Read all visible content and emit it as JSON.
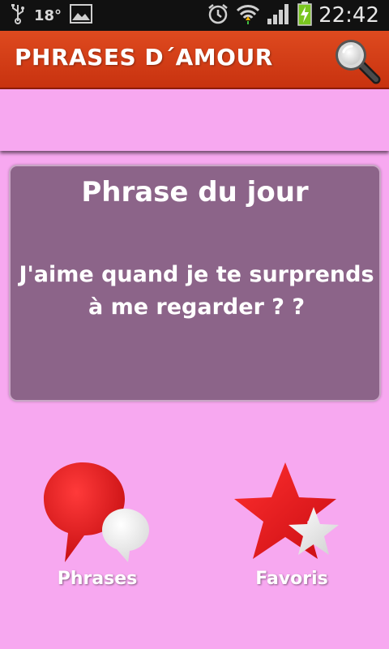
{
  "status_bar": {
    "temperature": "18°",
    "time": "22:42",
    "icons": [
      "usb-icon",
      "picture-icon",
      "alarm-icon",
      "wifi-icon",
      "signal-icon",
      "battery-charging-icon"
    ]
  },
  "action_bar": {
    "title": "PHRASES D´AMOUR",
    "search_icon": "search-icon"
  },
  "card": {
    "title": "Phrase du jour",
    "phrase": "J'aime quand je te surprends à me regarder ? ?"
  },
  "nav": {
    "phrases_label": "Phrases",
    "favoris_label": "Favoris"
  },
  "colors": {
    "background": "#f7a8f0",
    "action_bar": "#d33f17",
    "card": "#8c6489",
    "icon_red": "#e8171b"
  }
}
